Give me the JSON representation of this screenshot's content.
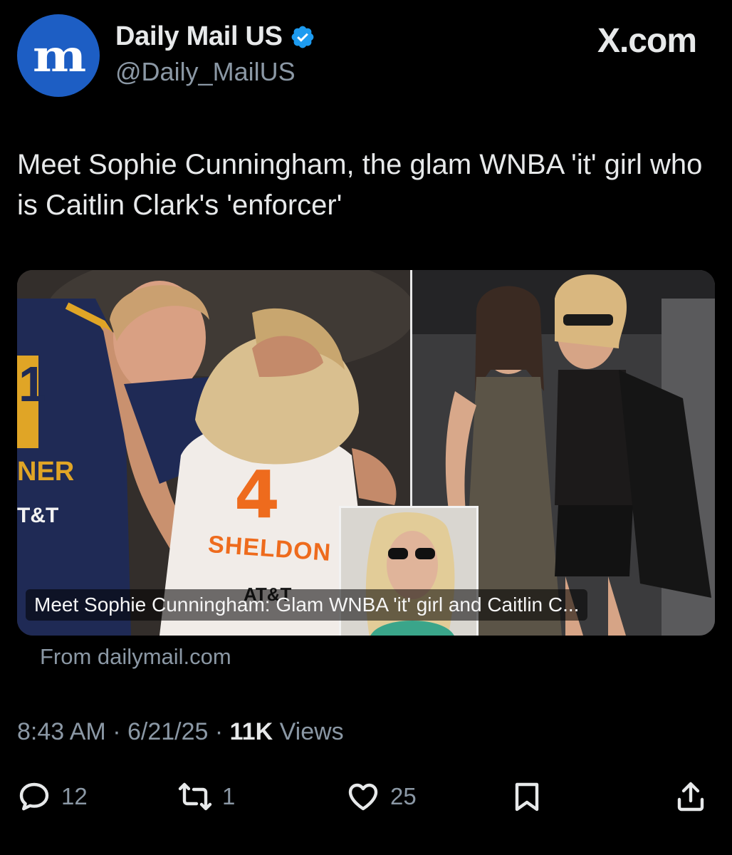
{
  "header": {
    "avatar_glyph": "m",
    "display_name": "Daily Mail US",
    "handle": "@Daily_MailUS",
    "brand": "X.com",
    "verified_color": "#1d9bf0"
  },
  "tweet": {
    "text": "Meet Sophie Cunningham, the glam WNBA 'it' girl who is Caitlin Clark's 'enforcer'"
  },
  "card": {
    "jersey_number": "4",
    "jersey_name": "SHELDON",
    "sponsor": "AT&T",
    "left_jersey_number": "1",
    "left_jersey_name": "NER",
    "left_sponsor": "T&T",
    "caption": "Meet Sophie Cunningham: Glam WNBA 'it' girl and Caitlin C...",
    "source": "From dailymail.com"
  },
  "meta": {
    "time": "8:43 AM",
    "sep1": " · ",
    "date": "6/21/25",
    "sep2": " · ",
    "views_count": "11K",
    "views_label": " Views"
  },
  "actions": {
    "replies": "12",
    "reposts": "1",
    "likes": "25"
  },
  "icons": {
    "reply": "reply-icon",
    "repost": "repost-icon",
    "like": "heart-icon",
    "bookmark": "bookmark-icon",
    "share": "share-icon"
  }
}
